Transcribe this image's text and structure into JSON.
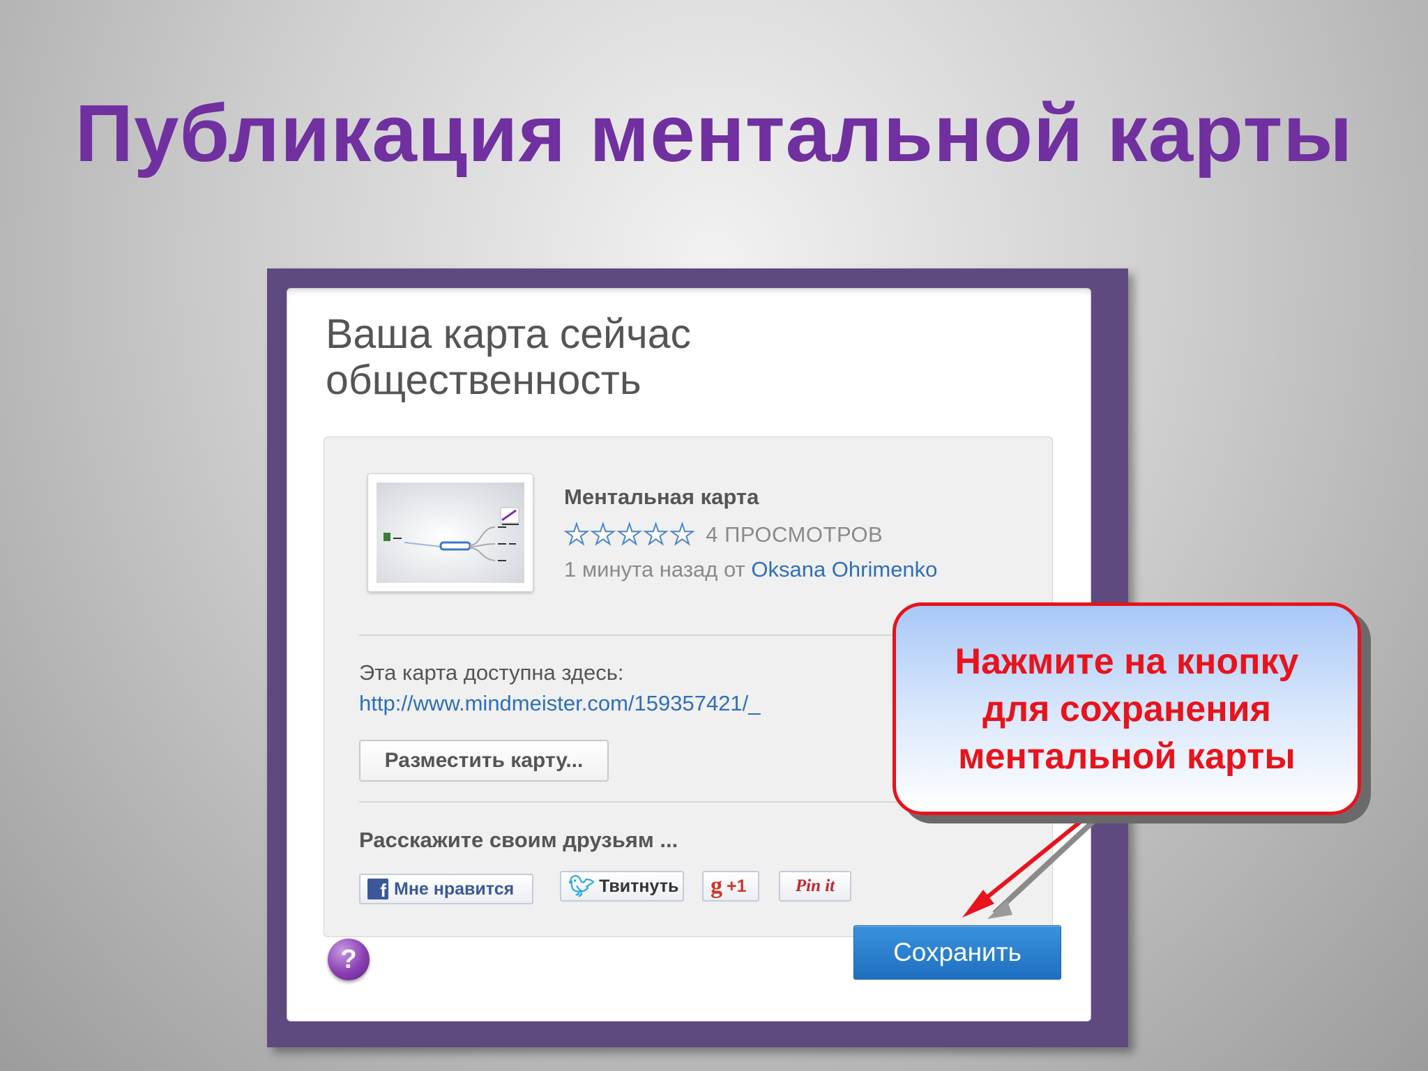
{
  "slide": {
    "title": "Публикация ментальной карты"
  },
  "dialog": {
    "title_line1": "Ваша карта сейчас",
    "title_line2": "общественность",
    "map": {
      "name": "Ментальная карта",
      "rating_stars_filled": 0,
      "rating_stars_total": 5,
      "views": "4 ПРОСМОТРОВ",
      "time_text": "1 минута назад от",
      "author": "Oksana Ohrimenko"
    },
    "available_label": "Эта карта доступна здесь:",
    "link": "http://www.mindmeister.com/159357421/_",
    "embed_button": "Разместить карту...",
    "share_label": "Расскажите своим друзьям ...",
    "social": {
      "facebook": "Мне нравится",
      "twitter": "Твитнуть",
      "google": "+1",
      "pinterest": "Pin it"
    },
    "help": "?",
    "save_button": "Сохранить"
  },
  "callout": {
    "line1": "Нажмите на кнопку",
    "line2": "для сохранения",
    "line3": "ментальной карты"
  },
  "colors": {
    "title": "#7030a0",
    "frame": "#5f4a7f",
    "callout_text": "#e8131b",
    "link": "#2f6fb6",
    "save_button": "#2a80d0"
  }
}
